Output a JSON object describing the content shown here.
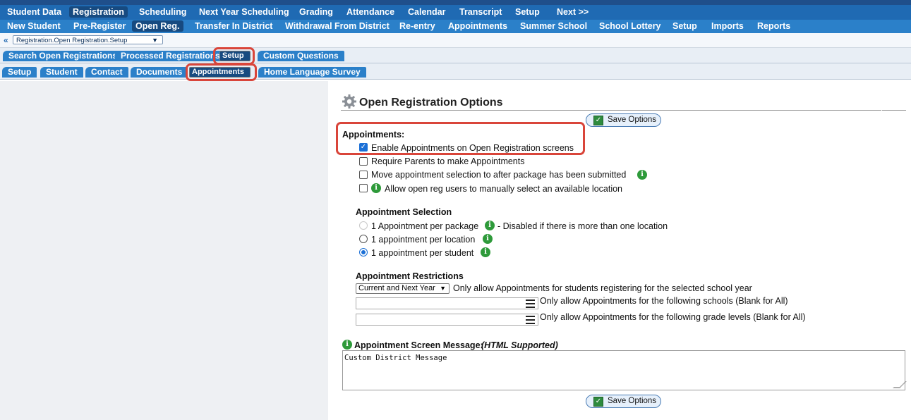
{
  "top_nav": [
    "Student Data",
    "Registration",
    "Scheduling",
    "Next Year Scheduling",
    "Grading",
    "Attendance",
    "Calendar",
    "Transcript",
    "Setup",
    "Next >>"
  ],
  "sub_nav": [
    "New Student",
    "Pre-Register",
    "Open Reg.",
    "Transfer In District",
    "Withdrawal From District",
    "Re-entry",
    "Appointments",
    "Summer School",
    "School Lottery",
    "Setup",
    "Imports",
    "Reports"
  ],
  "breadcrumb": {
    "arrow": "«",
    "value": "Registration.Open Registration.Setup"
  },
  "tabs1": [
    "Search Open Registrations",
    "Processed Registrations",
    "Setup",
    "Custom Questions"
  ],
  "tabs2": [
    "Setup",
    "Student",
    "Contact",
    "Documents",
    "Appointments",
    "Home Language Survey"
  ],
  "title": "Open Registration Options",
  "save_label": "Save Options",
  "appointments": {
    "heading": "Appointments:",
    "options": [
      "Enable Appointments on Open Registration screens",
      "Require Parents to make Appointments",
      "Move appointment selection to after package has been submitted",
      "Allow open reg users to manually select an available location"
    ]
  },
  "selection": {
    "heading": "Appointment Selection",
    "opt1": "1 Appointment per package",
    "opt1_note": "- Disabled if there is more than one location",
    "opt2": "1 appointment per location",
    "opt3": "1 appointment per student"
  },
  "restrictions": {
    "heading": "Appointment Restrictions",
    "year_value": "Current and Next Year",
    "year_text": "Only allow Appointments for students registering for the selected school year",
    "schools_text": "Only allow Appointments for the following schools (Blank for All)",
    "grades_text": "Only allow Appointments for the following grade levels (Blank for All)"
  },
  "message": {
    "label": "Appointment Screen Message:",
    "label_note": "(HTML Supported)",
    "value": "Custom District Message"
  }
}
